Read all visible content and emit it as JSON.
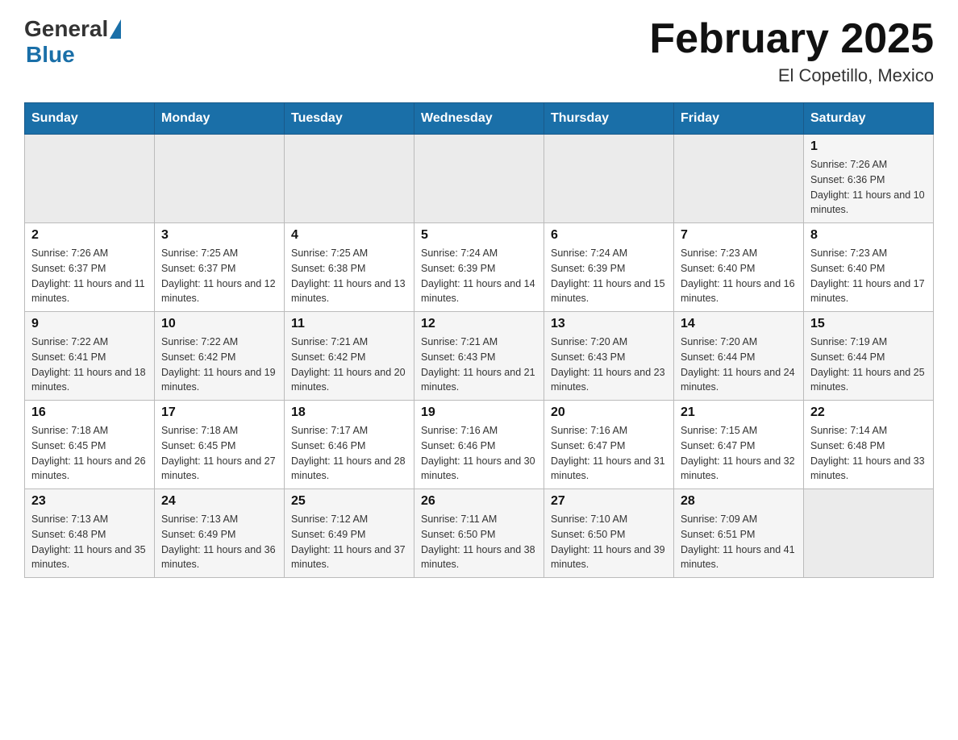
{
  "header": {
    "logo_general": "General",
    "logo_blue": "Blue",
    "month_title": "February 2025",
    "location": "El Copetillo, Mexico"
  },
  "days_of_week": [
    "Sunday",
    "Monday",
    "Tuesday",
    "Wednesday",
    "Thursday",
    "Friday",
    "Saturday"
  ],
  "weeks": [
    [
      {
        "day": "",
        "sunrise": "",
        "sunset": "",
        "daylight": ""
      },
      {
        "day": "",
        "sunrise": "",
        "sunset": "",
        "daylight": ""
      },
      {
        "day": "",
        "sunrise": "",
        "sunset": "",
        "daylight": ""
      },
      {
        "day": "",
        "sunrise": "",
        "sunset": "",
        "daylight": ""
      },
      {
        "day": "",
        "sunrise": "",
        "sunset": "",
        "daylight": ""
      },
      {
        "day": "",
        "sunrise": "",
        "sunset": "",
        "daylight": ""
      },
      {
        "day": "1",
        "sunrise": "Sunrise: 7:26 AM",
        "sunset": "Sunset: 6:36 PM",
        "daylight": "Daylight: 11 hours and 10 minutes."
      }
    ],
    [
      {
        "day": "2",
        "sunrise": "Sunrise: 7:26 AM",
        "sunset": "Sunset: 6:37 PM",
        "daylight": "Daylight: 11 hours and 11 minutes."
      },
      {
        "day": "3",
        "sunrise": "Sunrise: 7:25 AM",
        "sunset": "Sunset: 6:37 PM",
        "daylight": "Daylight: 11 hours and 12 minutes."
      },
      {
        "day": "4",
        "sunrise": "Sunrise: 7:25 AM",
        "sunset": "Sunset: 6:38 PM",
        "daylight": "Daylight: 11 hours and 13 minutes."
      },
      {
        "day": "5",
        "sunrise": "Sunrise: 7:24 AM",
        "sunset": "Sunset: 6:39 PM",
        "daylight": "Daylight: 11 hours and 14 minutes."
      },
      {
        "day": "6",
        "sunrise": "Sunrise: 7:24 AM",
        "sunset": "Sunset: 6:39 PM",
        "daylight": "Daylight: 11 hours and 15 minutes."
      },
      {
        "day": "7",
        "sunrise": "Sunrise: 7:23 AM",
        "sunset": "Sunset: 6:40 PM",
        "daylight": "Daylight: 11 hours and 16 minutes."
      },
      {
        "day": "8",
        "sunrise": "Sunrise: 7:23 AM",
        "sunset": "Sunset: 6:40 PM",
        "daylight": "Daylight: 11 hours and 17 minutes."
      }
    ],
    [
      {
        "day": "9",
        "sunrise": "Sunrise: 7:22 AM",
        "sunset": "Sunset: 6:41 PM",
        "daylight": "Daylight: 11 hours and 18 minutes."
      },
      {
        "day": "10",
        "sunrise": "Sunrise: 7:22 AM",
        "sunset": "Sunset: 6:42 PM",
        "daylight": "Daylight: 11 hours and 19 minutes."
      },
      {
        "day": "11",
        "sunrise": "Sunrise: 7:21 AM",
        "sunset": "Sunset: 6:42 PM",
        "daylight": "Daylight: 11 hours and 20 minutes."
      },
      {
        "day": "12",
        "sunrise": "Sunrise: 7:21 AM",
        "sunset": "Sunset: 6:43 PM",
        "daylight": "Daylight: 11 hours and 21 minutes."
      },
      {
        "day": "13",
        "sunrise": "Sunrise: 7:20 AM",
        "sunset": "Sunset: 6:43 PM",
        "daylight": "Daylight: 11 hours and 23 minutes."
      },
      {
        "day": "14",
        "sunrise": "Sunrise: 7:20 AM",
        "sunset": "Sunset: 6:44 PM",
        "daylight": "Daylight: 11 hours and 24 minutes."
      },
      {
        "day": "15",
        "sunrise": "Sunrise: 7:19 AM",
        "sunset": "Sunset: 6:44 PM",
        "daylight": "Daylight: 11 hours and 25 minutes."
      }
    ],
    [
      {
        "day": "16",
        "sunrise": "Sunrise: 7:18 AM",
        "sunset": "Sunset: 6:45 PM",
        "daylight": "Daylight: 11 hours and 26 minutes."
      },
      {
        "day": "17",
        "sunrise": "Sunrise: 7:18 AM",
        "sunset": "Sunset: 6:45 PM",
        "daylight": "Daylight: 11 hours and 27 minutes."
      },
      {
        "day": "18",
        "sunrise": "Sunrise: 7:17 AM",
        "sunset": "Sunset: 6:46 PM",
        "daylight": "Daylight: 11 hours and 28 minutes."
      },
      {
        "day": "19",
        "sunrise": "Sunrise: 7:16 AM",
        "sunset": "Sunset: 6:46 PM",
        "daylight": "Daylight: 11 hours and 30 minutes."
      },
      {
        "day": "20",
        "sunrise": "Sunrise: 7:16 AM",
        "sunset": "Sunset: 6:47 PM",
        "daylight": "Daylight: 11 hours and 31 minutes."
      },
      {
        "day": "21",
        "sunrise": "Sunrise: 7:15 AM",
        "sunset": "Sunset: 6:47 PM",
        "daylight": "Daylight: 11 hours and 32 minutes."
      },
      {
        "day": "22",
        "sunrise": "Sunrise: 7:14 AM",
        "sunset": "Sunset: 6:48 PM",
        "daylight": "Daylight: 11 hours and 33 minutes."
      }
    ],
    [
      {
        "day": "23",
        "sunrise": "Sunrise: 7:13 AM",
        "sunset": "Sunset: 6:48 PM",
        "daylight": "Daylight: 11 hours and 35 minutes."
      },
      {
        "day": "24",
        "sunrise": "Sunrise: 7:13 AM",
        "sunset": "Sunset: 6:49 PM",
        "daylight": "Daylight: 11 hours and 36 minutes."
      },
      {
        "day": "25",
        "sunrise": "Sunrise: 7:12 AM",
        "sunset": "Sunset: 6:49 PM",
        "daylight": "Daylight: 11 hours and 37 minutes."
      },
      {
        "day": "26",
        "sunrise": "Sunrise: 7:11 AM",
        "sunset": "Sunset: 6:50 PM",
        "daylight": "Daylight: 11 hours and 38 minutes."
      },
      {
        "day": "27",
        "sunrise": "Sunrise: 7:10 AM",
        "sunset": "Sunset: 6:50 PM",
        "daylight": "Daylight: 11 hours and 39 minutes."
      },
      {
        "day": "28",
        "sunrise": "Sunrise: 7:09 AM",
        "sunset": "Sunset: 6:51 PM",
        "daylight": "Daylight: 11 hours and 41 minutes."
      },
      {
        "day": "",
        "sunrise": "",
        "sunset": "",
        "daylight": ""
      }
    ]
  ]
}
